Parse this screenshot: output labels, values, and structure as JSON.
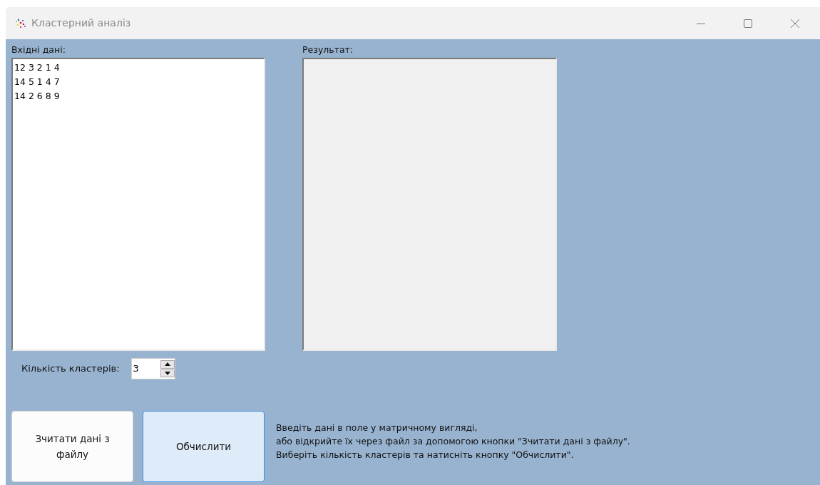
{
  "window": {
    "title": "Кластерний аналіз"
  },
  "input": {
    "label": "Вхідні дані:",
    "lines": [
      "12 3 2 1 4",
      "14 5 1 4 7",
      "14 2 6 8 9"
    ]
  },
  "result": {
    "label": "Результат:"
  },
  "clusters": {
    "label": "Кількість кластерів:",
    "value": "3"
  },
  "buttons": [
    {
      "label": "Зчитати дані з файлу",
      "focused": false
    },
    {
      "label": "Обчислити",
      "focused": true
    }
  ],
  "instructions": [
    "Введіть дані в поле у матричному вигляді,",
    "або відкрийте їх через файл за допомогою кнопки \"Зчитати дані з файлу\".",
    "Виберіть кількість кластерів та натисніть кнопку \"Обчислити\"."
  ]
}
